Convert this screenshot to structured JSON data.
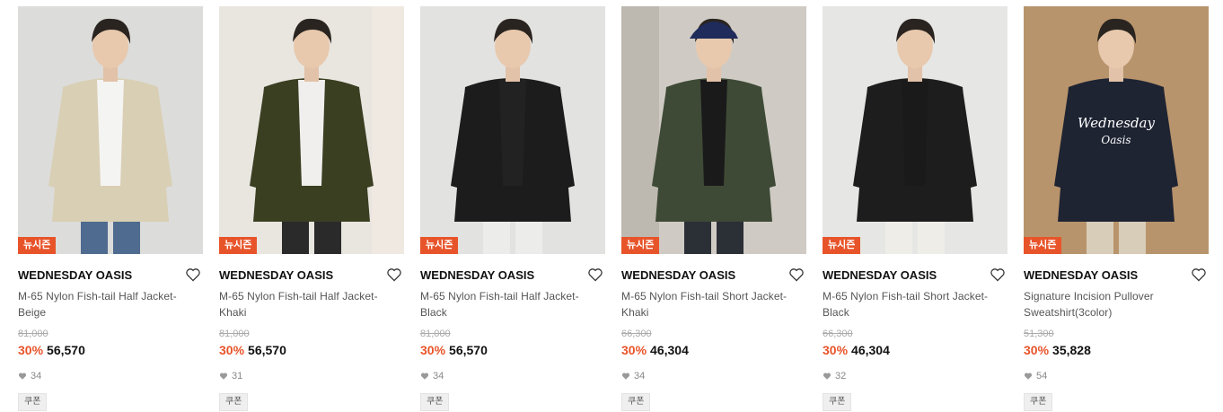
{
  "products": [
    {
      "badge": "뉴시즌",
      "brand": "WEDNESDAY OASIS",
      "name_line1": "M-65 Nylon Fish-tail Half Jacket-",
      "name_line2": "Beige",
      "original_price": "81,000",
      "discount": "30%",
      "price": "56,570",
      "likes": "34",
      "coupon": "쿠폰",
      "bg_color": "#dcdcda",
      "jacket_color": "#d9cfb4",
      "inner_color": "#f4f4f2",
      "pants_color": "#4f6b8f"
    },
    {
      "badge": "뉴시즌",
      "brand": "WEDNESDAY OASIS",
      "name_line1": "M-65 Nylon Fish-tail Half Jacket-",
      "name_line2": "Khaki",
      "original_price": "81,000",
      "discount": "30%",
      "price": "56,570",
      "likes": "31",
      "coupon": "쿠폰",
      "bg_color": "#e9e5df",
      "jacket_color": "#3b3f22",
      "inner_color": "#f0efed",
      "pants_color": "#2a2a2a"
    },
    {
      "badge": "뉴시즌",
      "brand": "WEDNESDAY OASIS",
      "name_line1": "M-65 Nylon Fish-tail Half Jacket-",
      "name_line2": "Black",
      "original_price": "81,000",
      "discount": "30%",
      "price": "56,570",
      "likes": "34",
      "coupon": "쿠폰",
      "bg_color": "#e2e2e0",
      "jacket_color": "#1c1c1c",
      "inner_color": "#222222",
      "pants_color": "#ececea"
    },
    {
      "badge": "뉴시즌",
      "brand": "WEDNESDAY OASIS",
      "name_line1": "M-65 Nylon Fish-tail Short Jacket-",
      "name_line2": "Khaki",
      "original_price": "66,300",
      "discount": "30%",
      "price": "46,304",
      "likes": "34",
      "coupon": "쿠폰",
      "bg_color": "#cfcbc4",
      "jacket_color": "#3e4a36",
      "inner_color": "#1a1a1a",
      "pants_color": "#2b2f36"
    },
    {
      "badge": "뉴시즌",
      "brand": "WEDNESDAY OASIS",
      "name_line1": "M-65 Nylon Fish-tail Short Jacket-",
      "name_line2": "Black",
      "original_price": "66,300",
      "discount": "30%",
      "price": "46,304",
      "likes": "32",
      "coupon": "쿠폰",
      "bg_color": "#e6e6e4",
      "jacket_color": "#1d1d1d",
      "inner_color": "#1a1a1a",
      "pants_color": "#eeede8"
    },
    {
      "badge": "뉴시즌",
      "brand": "WEDNESDAY OASIS",
      "name_line1": "Signature Incision Pullover",
      "name_line2": "Sweatshirt(3color)",
      "original_price": "51,300",
      "discount": "30%",
      "price": "35,828",
      "likes": "54",
      "coupon": "쿠폰",
      "bg_color": "#b8946c",
      "jacket_color": "#1f2433",
      "inner_color": "#ffffff",
      "pants_color": "#d8cdb8",
      "print_line1": "Wednesday",
      "print_line2": "Oasis"
    }
  ],
  "colors": {
    "accent": "#e8542a",
    "price": "#111111",
    "muted": "#aaaaaa"
  },
  "icons": {
    "wishlist": "heart-outline-icon",
    "likes": "heart-filled-icon"
  }
}
